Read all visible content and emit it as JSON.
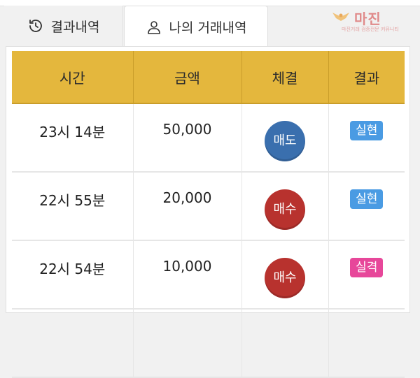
{
  "tabs": [
    {
      "label": "결과내역",
      "icon": "history-icon"
    },
    {
      "label": "나의 거래내역",
      "icon": "user-icon"
    }
  ],
  "logo": {
    "text": "마진",
    "subtext": "마진거래 검증전문 커뮤니티"
  },
  "table": {
    "headers": [
      "시간",
      "금액",
      "체결",
      "결과"
    ],
    "rows": [
      {
        "time": "23시 14분",
        "amount": "50,000",
        "trade": "매도",
        "trade_color": "#3a6fae",
        "result": "실현",
        "result_color": "#4a9be3"
      },
      {
        "time": "22시 55분",
        "amount": "20,000",
        "trade": "매수",
        "trade_color": "#b8322e",
        "result": "실현",
        "result_color": "#4a9be3"
      },
      {
        "time": "22시 54분",
        "amount": "10,000",
        "trade": "매수",
        "trade_color": "#b8322e",
        "result": "실격",
        "result_color": "#e7479a"
      }
    ]
  },
  "colors": {
    "header_bg": "#e4b73d"
  }
}
